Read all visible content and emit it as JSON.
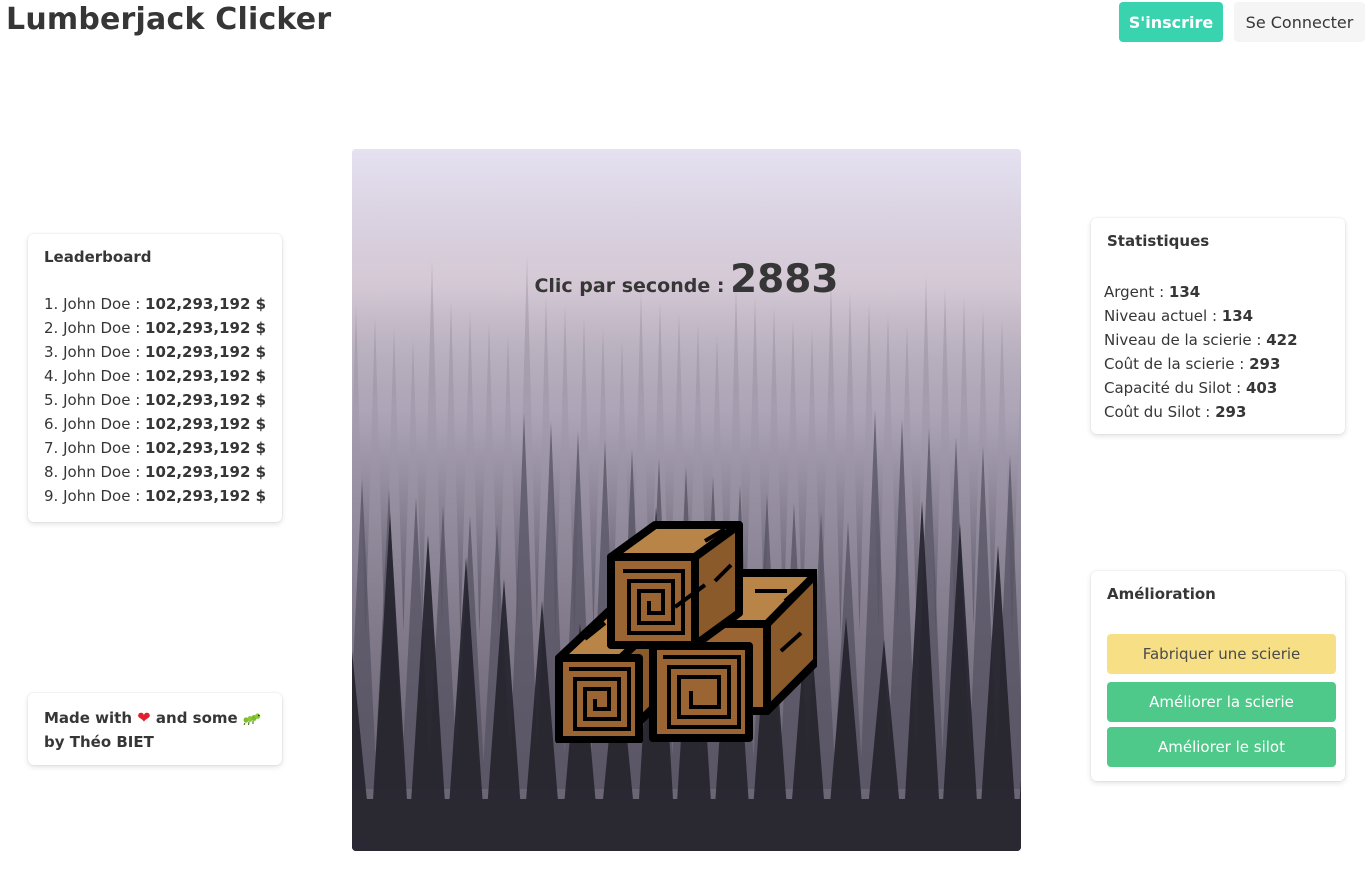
{
  "header": {
    "title": "Lumberjack Clicker",
    "signup_label": "S'inscrire",
    "login_label": "Se Connecter"
  },
  "leaderboard": {
    "title": "Leaderboard",
    "entries": [
      {
        "rank": "1.",
        "name": "John Doe :",
        "score": "102,293,192 $"
      },
      {
        "rank": "2.",
        "name": "John Doe :",
        "score": "102,293,192 $"
      },
      {
        "rank": "3.",
        "name": "John Doe :",
        "score": "102,293,192 $"
      },
      {
        "rank": "4.",
        "name": "John Doe :",
        "score": "102,293,192 $"
      },
      {
        "rank": "5.",
        "name": "John Doe :",
        "score": "102,293,192 $"
      },
      {
        "rank": "6.",
        "name": "John Doe :",
        "score": "102,293,192 $"
      },
      {
        "rank": "7.",
        "name": "John Doe :",
        "score": "102,293,192 $"
      },
      {
        "rank": "8.",
        "name": "John Doe :",
        "score": "102,293,192 $"
      },
      {
        "rank": "9.",
        "name": "John Doe :",
        "score": "102,293,192 $"
      }
    ]
  },
  "credits": {
    "line1_prefix": "Made with",
    "line1_middle": "and some",
    "line2": "by Théo BIET",
    "heart_icon": "heart-icon",
    "bug_icon": "bug-icon"
  },
  "game": {
    "cps_label": "Clic par seconde :",
    "cps_value": "2883",
    "clicker_icon": "wood-logs-icon"
  },
  "stats": {
    "title": "Statistiques",
    "items": [
      {
        "label": "Argent :",
        "value": "134"
      },
      {
        "label": "Niveau actuel :",
        "value": "134"
      },
      {
        "label": "Niveau de la scierie :",
        "value": "422"
      },
      {
        "label": "Coût de la scierie :",
        "value": "293"
      },
      {
        "label": "Capacité du Silot :",
        "value": "403"
      },
      {
        "label": "Coût du Silot :",
        "value": "293"
      }
    ]
  },
  "upgrades": {
    "title": "Amélioration",
    "build_sawmill": "Fabriquer une scierie",
    "upgrade_sawmill": "Améliorer la scierie",
    "upgrade_silo": "Améliorer le silot"
  },
  "colors": {
    "primary": "#3ad3b0",
    "success": "#4fc98a",
    "warning": "#f7df86",
    "text": "#363636"
  }
}
